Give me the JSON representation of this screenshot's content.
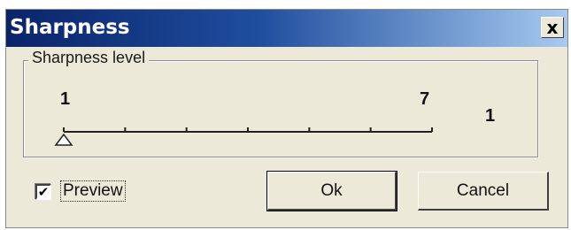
{
  "window": {
    "title": "Sharpness",
    "close_label": "x"
  },
  "group": {
    "label": "Sharpness level"
  },
  "slider": {
    "min_label": "1",
    "max_label": "7",
    "min": 1,
    "max": 7,
    "value": 1,
    "tick_count": 7,
    "value_readout": "1"
  },
  "preview": {
    "label": "Preview",
    "checked": true,
    "check_glyph": "✔"
  },
  "buttons": {
    "ok_label": "Ok",
    "cancel_label": "Cancel"
  },
  "colors": {
    "title_bar_start": "#0a246a",
    "title_bar_end": "#a6caf0",
    "dialog_face": "#ece9d8"
  }
}
